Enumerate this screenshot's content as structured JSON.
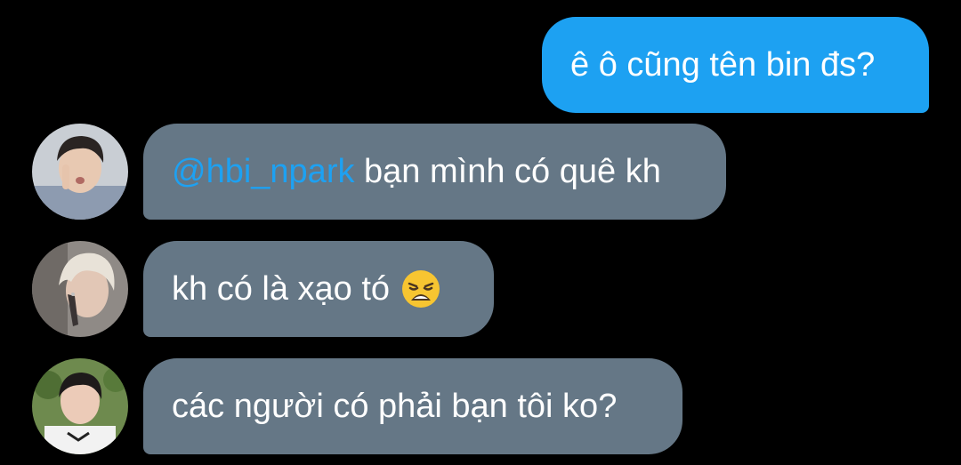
{
  "messages": [
    {
      "direction": "outgoing",
      "text": "ê ô cũng tên bin đs?"
    },
    {
      "direction": "incoming",
      "mention": "@hbi_npark",
      "text": " bạn mình có quê kh",
      "avatar": "avatar-user-1"
    },
    {
      "direction": "incoming",
      "text": "kh có là xạo tó",
      "emoji": "weary-face-icon",
      "avatar": "avatar-user-2"
    },
    {
      "direction": "incoming",
      "text": "các người có phải bạn tôi ko?",
      "avatar": "avatar-user-3"
    }
  ],
  "colors": {
    "background": "#000000",
    "outgoing_bubble": "#1da1f2",
    "incoming_bubble": "#657786",
    "mention": "#1da1f2",
    "text": "#ffffff"
  }
}
